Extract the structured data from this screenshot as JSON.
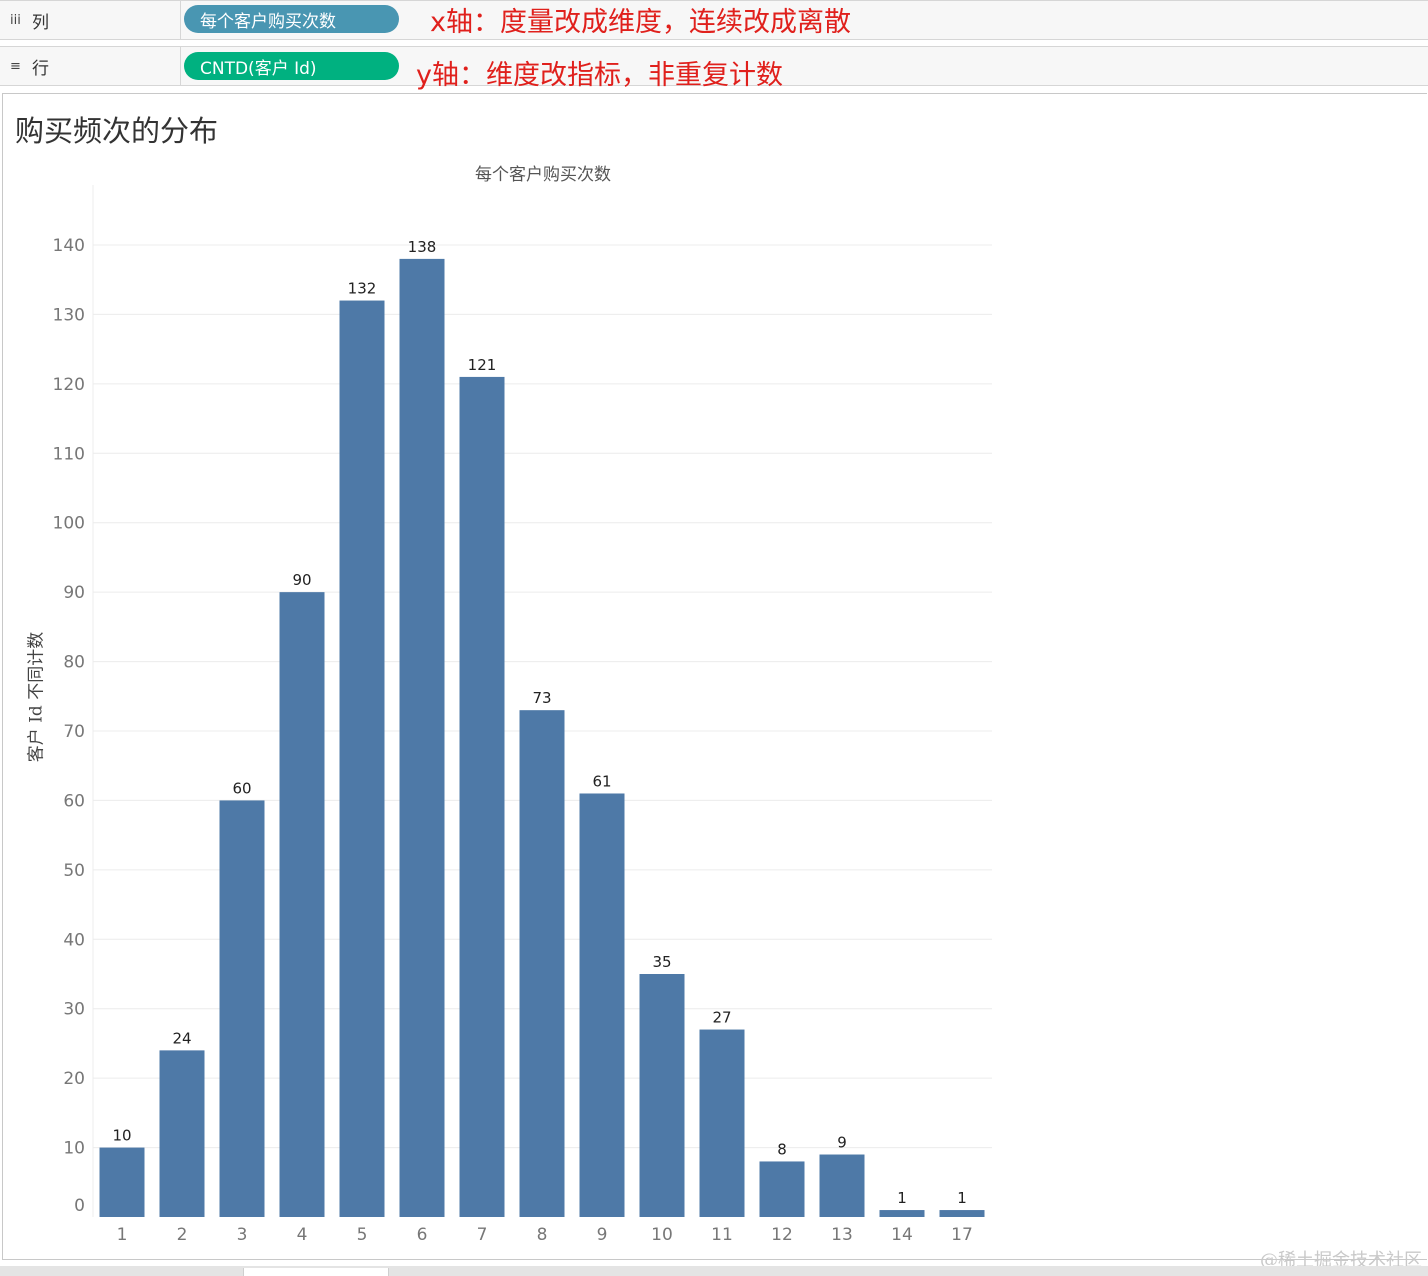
{
  "shelves": {
    "columns": {
      "label": "列",
      "icon": "columns-icon",
      "pill": "每个客户购买次数",
      "annotation": "x轴：度量改成维度，连续改成离散"
    },
    "rows": {
      "label": "行",
      "icon": "rows-icon",
      "pill": "CNTD(客户 Id)",
      "annotation": "y轴：维度改指标，非重复计数"
    }
  },
  "colors": {
    "bar": "#4e79a7",
    "discrete_pill": "#4996b2",
    "continuous_pill": "#00b180",
    "annotation": "#e0201c"
  },
  "sheet": {
    "title": "购买频次的分布"
  },
  "watermark": "@稀土掘金技术社区",
  "chart_data": {
    "type": "bar",
    "title": "购买频次的分布",
    "xlabel": "每个客户购买次数",
    "ylabel": "客户 Id 不同计数",
    "categories": [
      "1",
      "2",
      "3",
      "4",
      "5",
      "6",
      "7",
      "8",
      "9",
      "10",
      "11",
      "12",
      "13",
      "14",
      "17"
    ],
    "values": [
      10,
      24,
      60,
      90,
      132,
      138,
      121,
      73,
      61,
      35,
      27,
      8,
      9,
      1,
      1
    ],
    "y_ticks": [
      0,
      10,
      20,
      30,
      40,
      50,
      60,
      70,
      80,
      90,
      100,
      110,
      120,
      130,
      140
    ],
    "ylim": [
      0,
      140
    ],
    "grid": true,
    "data_labels": true
  }
}
